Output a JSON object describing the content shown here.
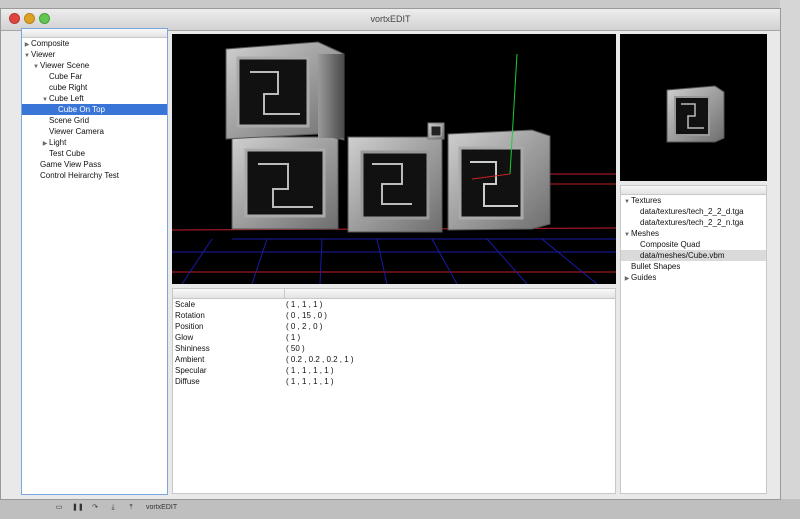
{
  "window": {
    "title": "vortxEDIT"
  },
  "scene_tree": {
    "items": [
      {
        "label": "Composite",
        "level": 0,
        "toggle": "collapsed"
      },
      {
        "label": "Viewer",
        "level": 0,
        "toggle": "expanded"
      },
      {
        "label": "Viewer Scene",
        "level": 1,
        "toggle": "expanded"
      },
      {
        "label": "Cube Far",
        "level": 2,
        "toggle": "none"
      },
      {
        "label": "cube Right",
        "level": 2,
        "toggle": "none"
      },
      {
        "label": "Cube Left",
        "level": 2,
        "toggle": "expanded"
      },
      {
        "label": "Cube On Top",
        "level": 3,
        "toggle": "none",
        "selected": true
      },
      {
        "label": "Scene Grid",
        "level": 2,
        "toggle": "none"
      },
      {
        "label": "Viewer Camera",
        "level": 2,
        "toggle": "none"
      },
      {
        "label": "Light",
        "level": 2,
        "toggle": "collapsed"
      },
      {
        "label": "Test Cube",
        "level": 2,
        "toggle": "none"
      },
      {
        "label": "Game View Pass",
        "level": 1,
        "toggle": "none"
      },
      {
        "label": "Control Heirarchy Test",
        "level": 1,
        "toggle": "none"
      }
    ]
  },
  "properties": [
    {
      "name": "Scale",
      "value": "( 1 , 1 , 1 )"
    },
    {
      "name": "Rotation",
      "value": "( 0 , 15 , 0 )"
    },
    {
      "name": "Position",
      "value": "( 0 , 2 , 0 )"
    },
    {
      "name": "Glow",
      "value": "( 1 )"
    },
    {
      "name": "Shininess",
      "value": "( 50 )"
    },
    {
      "name": "Ambient",
      "value": "( 0.2 , 0.2 , 0.2 , 1 )"
    },
    {
      "name": "Specular",
      "value": "( 1 , 1 , 1 , 1 )"
    },
    {
      "name": "Diffuse",
      "value": "( 1 , 1 , 1 , 1 )"
    }
  ],
  "assets": {
    "items": [
      {
        "label": "Textures",
        "level": 0,
        "toggle": "expanded"
      },
      {
        "label": "data/textures/tech_2_2_d.tga",
        "level": 1,
        "toggle": "none"
      },
      {
        "label": "data/textures/tech_2_2_n.tga",
        "level": 1,
        "toggle": "none"
      },
      {
        "label": "Meshes",
        "level": 0,
        "toggle": "expanded"
      },
      {
        "label": "Composite Quad",
        "level": 1,
        "toggle": "none"
      },
      {
        "label": "data/meshes/Cube.vbm",
        "level": 1,
        "toggle": "none",
        "highlighted": true
      },
      {
        "label": "Bullet Shapes",
        "level": 0,
        "toggle": "none"
      },
      {
        "label": "Guides",
        "level": 0,
        "toggle": "collapsed"
      }
    ]
  },
  "taskbar": {
    "label": "vortxEDIT"
  },
  "colors": {
    "selection": "#3875d7",
    "grid_red": "#c0202a",
    "grid_blue": "#1a1aa8",
    "axis_green": "#22cc33"
  }
}
